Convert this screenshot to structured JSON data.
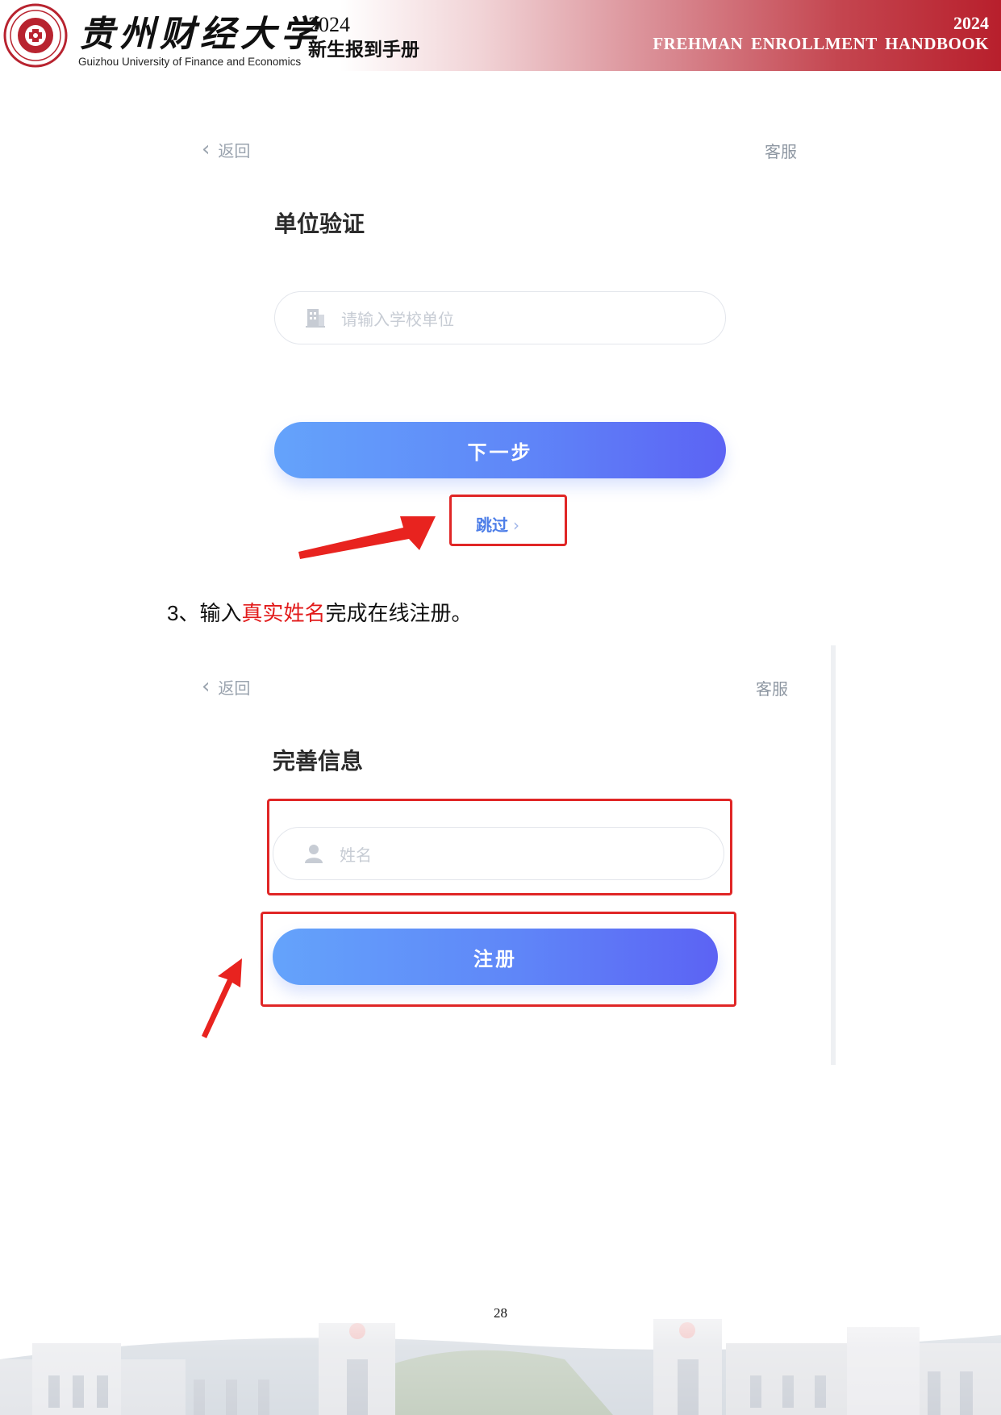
{
  "header": {
    "school_cn": "贵州财经大学",
    "school_en": "Guizhou University of Finance and Economics",
    "handbook_year": "2024",
    "handbook_title": "新生报到手册",
    "en_year": "2024",
    "en_title": "FREHMAN  ENROLLMENT  HANDBOOK"
  },
  "screen1": {
    "back_label": "返回",
    "service_label": "客服",
    "title": "单位验证",
    "input_placeholder": "请输入学校单位",
    "input_icon": "building-icon",
    "next_button": "下一步",
    "skip_label": "跳过"
  },
  "instruction": {
    "prefix_num": "3、",
    "before": "输入",
    "highlight": "真实姓名",
    "after": "完成在线注册。"
  },
  "screen2": {
    "back_label": "返回",
    "service_label": "客服",
    "title": "完善信息",
    "input_placeholder": "姓名",
    "input_icon": "user-icon",
    "register_button": "注册"
  },
  "footer": {
    "page_number": "28"
  },
  "colors": {
    "annotation_red": "#e02626",
    "button_blue_start": "#64a3fb",
    "button_blue_end": "#5c63f4",
    "banner_red": "#b81f2c"
  }
}
